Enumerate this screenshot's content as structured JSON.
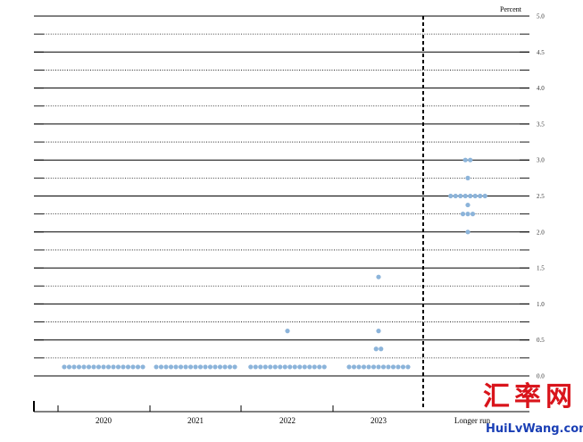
{
  "chart_data": {
    "type": "scatter",
    "title": "",
    "xlabel": "",
    "ylabel": "Percent",
    "ylim": [
      0,
      5
    ],
    "yticks": [
      "0.0",
      "0.5",
      "1.0",
      "1.5",
      "2.0",
      "2.5",
      "3.0",
      "3.5",
      "4.0",
      "4.5",
      "5.0"
    ],
    "categories": [
      "2020",
      "2021",
      "2022",
      "2023",
      "Longer run"
    ],
    "grid": true,
    "dot_color": "#8cb4da",
    "series": [
      {
        "x": "2020",
        "points": [
          {
            "y": 0.125,
            "count": 17
          }
        ]
      },
      {
        "x": "2021",
        "points": [
          {
            "y": 0.125,
            "count": 17
          }
        ]
      },
      {
        "x": "2022",
        "points": [
          {
            "y": 0.125,
            "count": 16
          },
          {
            "y": 0.625,
            "count": 1
          }
        ]
      },
      {
        "x": "2023",
        "points": [
          {
            "y": 0.125,
            "count": 13
          },
          {
            "y": 0.375,
            "count": 2
          },
          {
            "y": 0.625,
            "count": 1
          },
          {
            "y": 1.375,
            "count": 1
          }
        ]
      },
      {
        "x": "Longer run",
        "points": [
          {
            "y": 2.0,
            "count": 1
          },
          {
            "y": 2.25,
            "count": 3
          },
          {
            "y": 2.375,
            "count": 1
          },
          {
            "y": 2.5,
            "count": 8
          },
          {
            "y": 2.75,
            "count": 1
          },
          {
            "y": 3.0,
            "count": 2
          }
        ]
      }
    ]
  },
  "watermark": {
    "chinese": "汇率网",
    "url": "HuiLvWang.com"
  }
}
